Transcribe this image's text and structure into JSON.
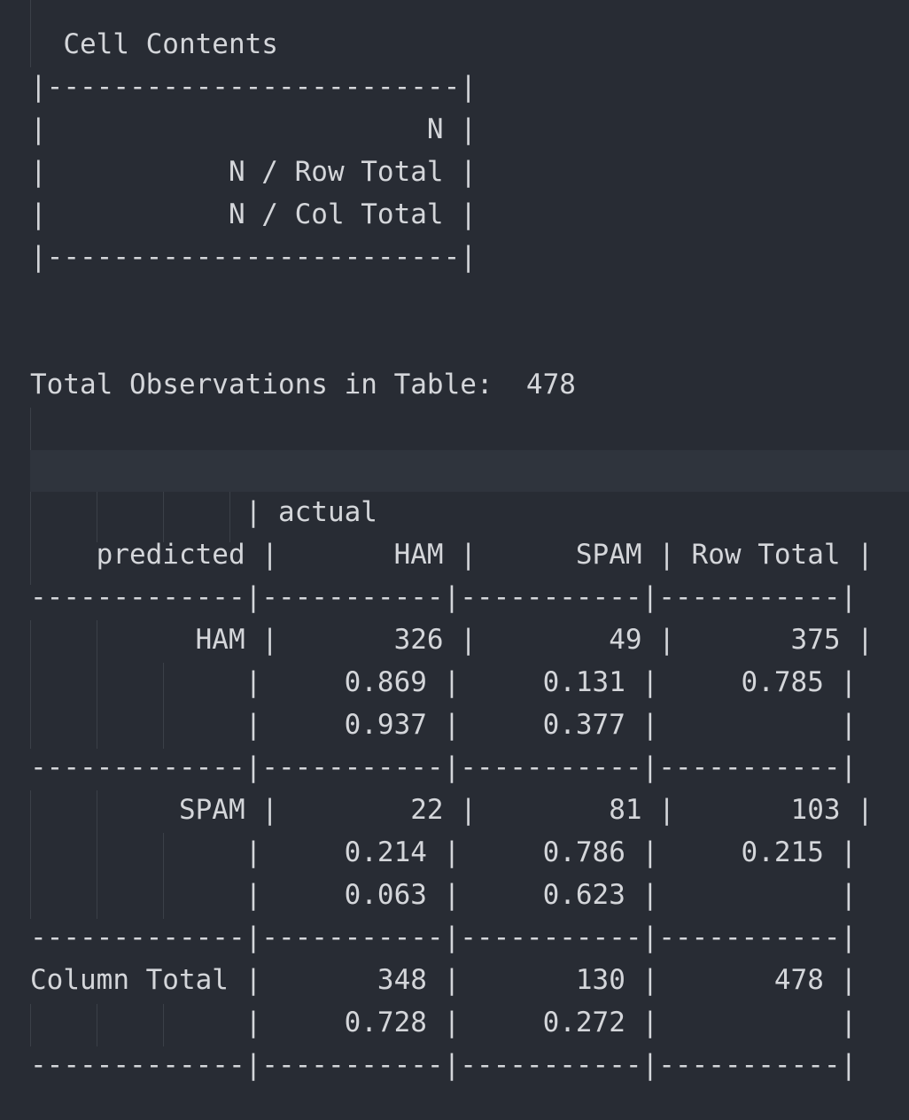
{
  "cell_contents": {
    "title": "  Cell Contents ",
    "lines": [
      "|-------------------------|",
      "|                       N |",
      "|           N / Row Total |",
      "|           N / Col Total |",
      "|-------------------------|"
    ]
  },
  "total_observations": "Total Observations in Table:  478 ",
  "crosstab": {
    "lines": [
      "             | actual ",
      "    predicted |       HAM |      SPAM | Row Total | ",
      "-------------|-----------|-----------|-----------|",
      "          HAM |       326 |        49 |       375 | ",
      "             |     0.869 |     0.131 |     0.785 | ",
      "             |     0.937 |     0.377 |           | ",
      "-------------|-----------|-----------|-----------|",
      "         SPAM |        22 |        81 |       103 | ",
      "             |     0.214 |     0.786 |     0.215 | ",
      "             |     0.063 |     0.623 |           | ",
      "-------------|-----------|-----------|-----------|",
      "Column Total |       348 |       130 |       478 | ",
      "             |     0.728 |     0.272 |           | ",
      "-------------|-----------|-----------|-----------|"
    ]
  },
  "colors": {
    "background": "#282c34",
    "text": "#d4d6da",
    "indent_guide": "#3b4048",
    "cursor_line": "#2f343d"
  }
}
